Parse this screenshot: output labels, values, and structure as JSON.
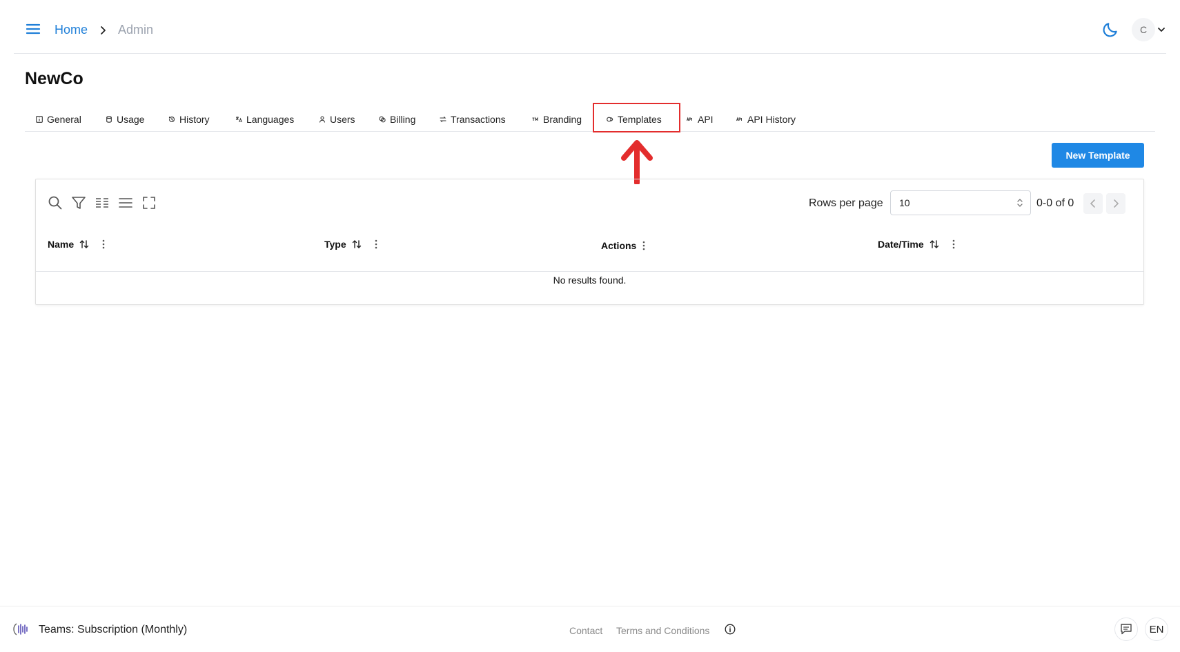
{
  "header": {
    "breadcrumb": {
      "home": "Home",
      "current": "Admin"
    },
    "avatar_initial": "C"
  },
  "org": {
    "name": "NewCo"
  },
  "tabs": [
    {
      "label": "General",
      "icon": "info-square-icon"
    },
    {
      "label": "Usage",
      "icon": "database-icon"
    },
    {
      "label": "History",
      "icon": "history-icon"
    },
    {
      "label": "Languages",
      "icon": "translate-icon"
    },
    {
      "label": "Users",
      "icon": "user-icon"
    },
    {
      "label": "Billing",
      "icon": "coins-icon"
    },
    {
      "label": "Transactions",
      "icon": "transfer-icon"
    },
    {
      "label": "Branding",
      "icon": "trademark-icon"
    },
    {
      "label": "Templates",
      "icon": "template-icon",
      "highlighted": true
    },
    {
      "label": "API",
      "icon": "api-icon"
    },
    {
      "label": "API History",
      "icon": "api-icon"
    }
  ],
  "actions": {
    "new_template": "New Template"
  },
  "table": {
    "rows_per_page_label": "Rows per page",
    "rows_per_page_value": "10",
    "page_range": "0-0 of 0",
    "columns": [
      "Name",
      "Type",
      "Actions",
      "Date/Time"
    ],
    "empty_message": "No results found."
  },
  "footer": {
    "plan": "Teams: Subscription (Monthly)",
    "contact": "Contact",
    "terms": "Terms and Conditions",
    "language": "EN"
  },
  "colors": {
    "accent": "#1f88e5",
    "link": "#1f7fd8",
    "highlight": "#e32d2d"
  }
}
